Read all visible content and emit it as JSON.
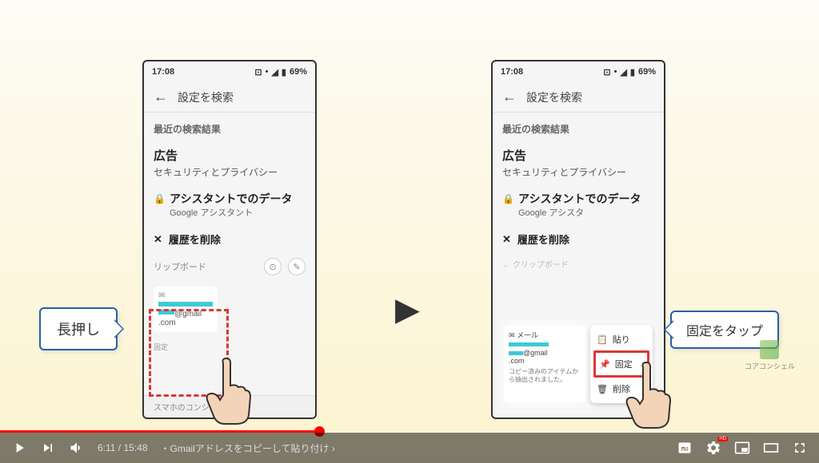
{
  "status_bar": {
    "time": "17:08",
    "battery": "69%"
  },
  "search_placeholder": "設定を検索",
  "section_recent": "最近の検索結果",
  "results": {
    "ad": {
      "title": "広告",
      "sub": "セキュリティとプライバシー"
    },
    "assistant": {
      "title": "アシスタントでのデータ",
      "sub": "Google アシスタント",
      "sub_trunc": "Google アシスタ"
    },
    "history": "履歴を削除"
  },
  "clipboard_label": "リップボード",
  "clipboard_label_full": "クリップボード",
  "email_frag": "@gmail",
  "email_dom": ".com",
  "pin_label": "固定",
  "bottom_suggest": "スマホのコンシェ",
  "callouts": {
    "longpress": "長押し",
    "tap_pin": "固定をタップ"
  },
  "menu": {
    "paste": "貼り",
    "pin": "固定",
    "delete": "削除"
  },
  "mail_label": "メール",
  "copied_note": "コピー済みのアイテムから抽出されました。",
  "logo_text": "コアコンシェル",
  "player": {
    "current": "6:11",
    "total": "15:48",
    "chapter_prefix": "・",
    "chapter": "Gmailアドレスをコピーして貼り付け",
    "chapter_arrow": "›"
  }
}
